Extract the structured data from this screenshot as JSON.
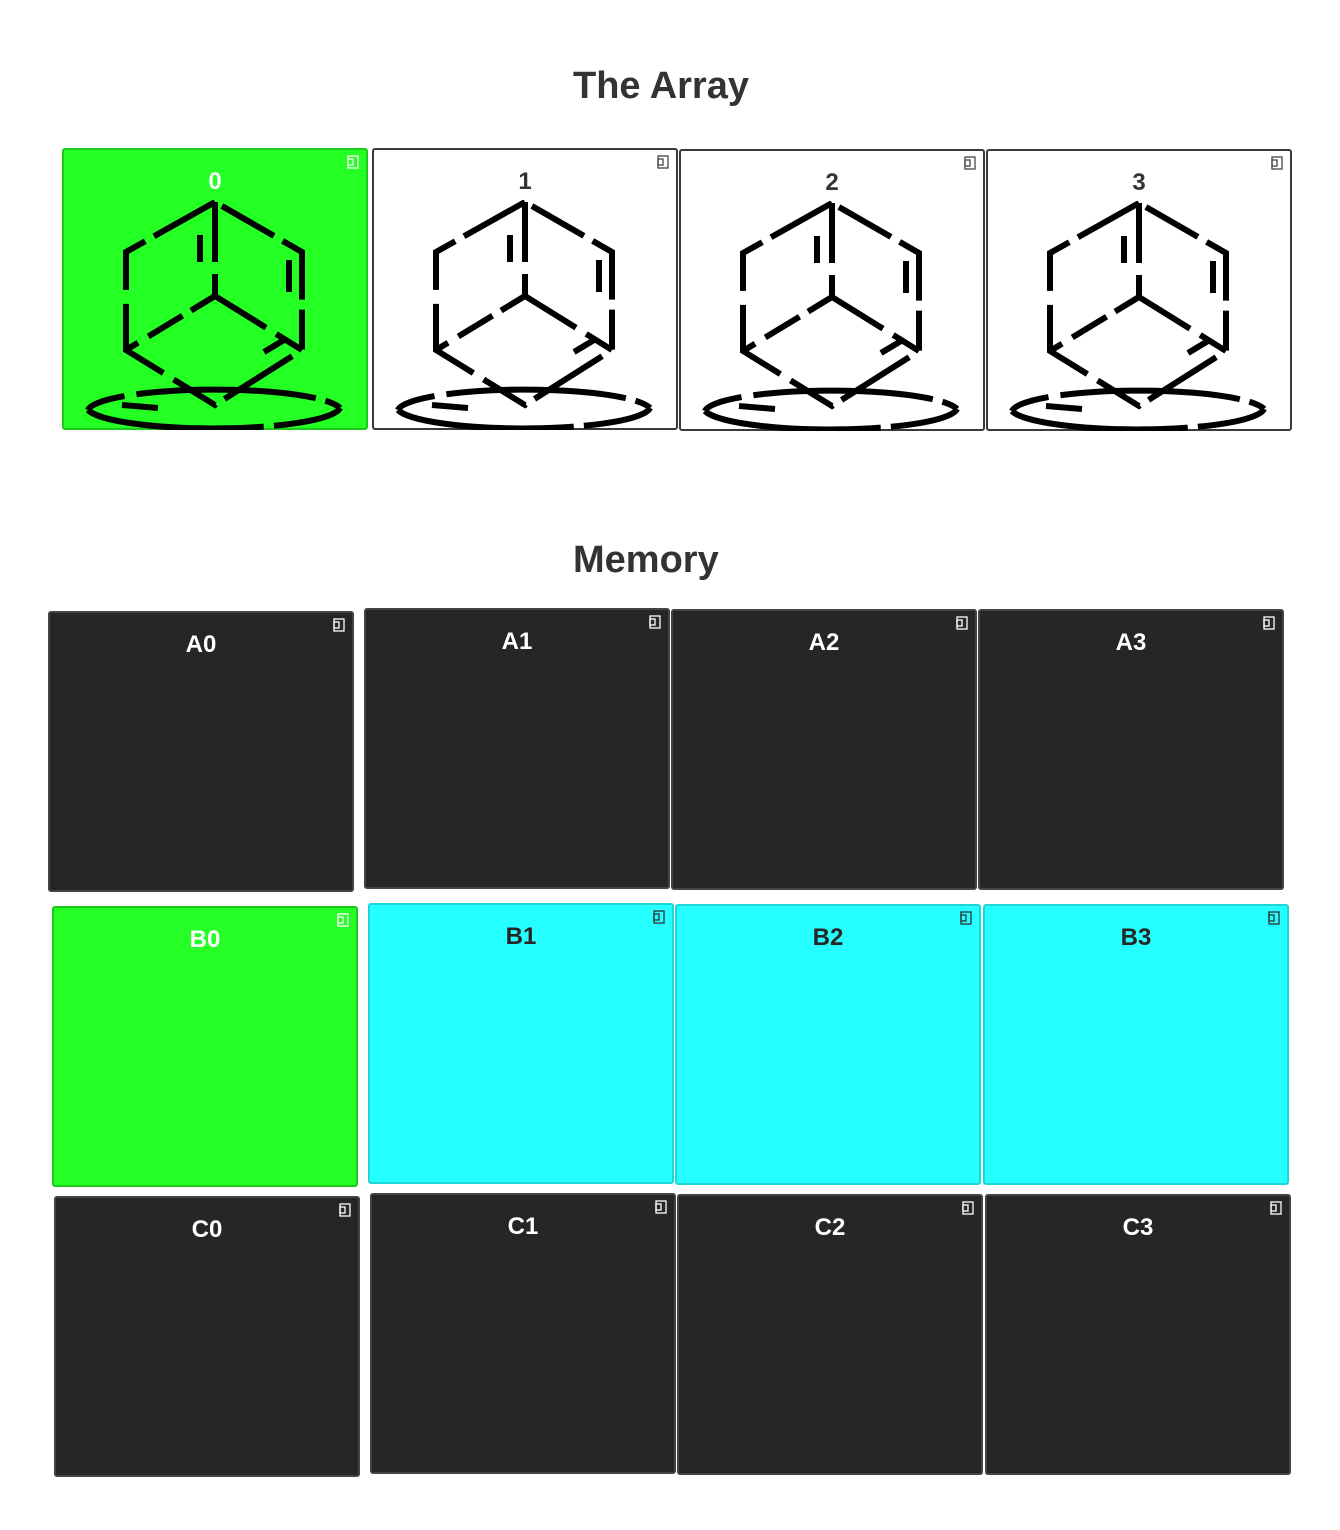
{
  "array": {
    "title": "The Array",
    "cells": [
      {
        "index": "0",
        "state": "active",
        "icon": "cube-on-ellipse-icon"
      },
      {
        "index": "1",
        "state": "normal",
        "icon": "cube-on-ellipse-icon"
      },
      {
        "index": "2",
        "state": "normal",
        "icon": "cube-on-ellipse-icon"
      },
      {
        "index": "3",
        "state": "normal",
        "icon": "cube-on-ellipse-icon"
      }
    ]
  },
  "memory": {
    "title": "Memory",
    "rows": [
      [
        {
          "label": "A0",
          "state": "default"
        },
        {
          "label": "A1",
          "state": "default"
        },
        {
          "label": "A2",
          "state": "default"
        },
        {
          "label": "A3",
          "state": "default"
        }
      ],
      [
        {
          "label": "B0",
          "state": "active"
        },
        {
          "label": "B1",
          "state": "highlighted"
        },
        {
          "label": "B2",
          "state": "highlighted"
        },
        {
          "label": "B3",
          "state": "highlighted"
        }
      ],
      [
        {
          "label": "C0",
          "state": "default"
        },
        {
          "label": "C1",
          "state": "default"
        },
        {
          "label": "C2",
          "state": "default"
        },
        {
          "label": "C3",
          "state": "default"
        }
      ]
    ]
  },
  "colors": {
    "active": "#26ff26",
    "highlighted": "#26ffff",
    "default_memory": "#262626",
    "text_dark": "#333333"
  },
  "icons": {
    "corner": "expand-corner-icon"
  }
}
